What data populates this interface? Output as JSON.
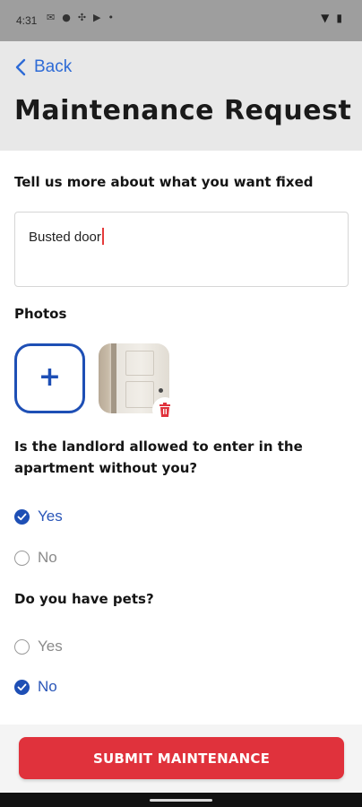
{
  "status_bar": {
    "time": "4:31"
  },
  "header": {
    "back_label": "Back",
    "title": "Maintenance Request"
  },
  "form": {
    "description_label": "Tell us more about what you want fixed",
    "description_value": "Busted door",
    "photos_label": "Photos",
    "add_photo_symbol": "+",
    "landlord_question": "Is the landlord allowed to enter in the apartment without you?",
    "landlord_options": [
      {
        "label": "Yes",
        "selected": true
      },
      {
        "label": "No",
        "selected": false
      }
    ],
    "pets_question": "Do you have pets?",
    "pets_options": [
      {
        "label": "Yes",
        "selected": false
      },
      {
        "label": "No",
        "selected": true
      }
    ]
  },
  "footer": {
    "submit_label": "SUBMIT MAINTENANCE"
  },
  "colors": {
    "accent": "#1e4fb5",
    "submit": "#e0323c",
    "link": "#2e6bd6"
  }
}
